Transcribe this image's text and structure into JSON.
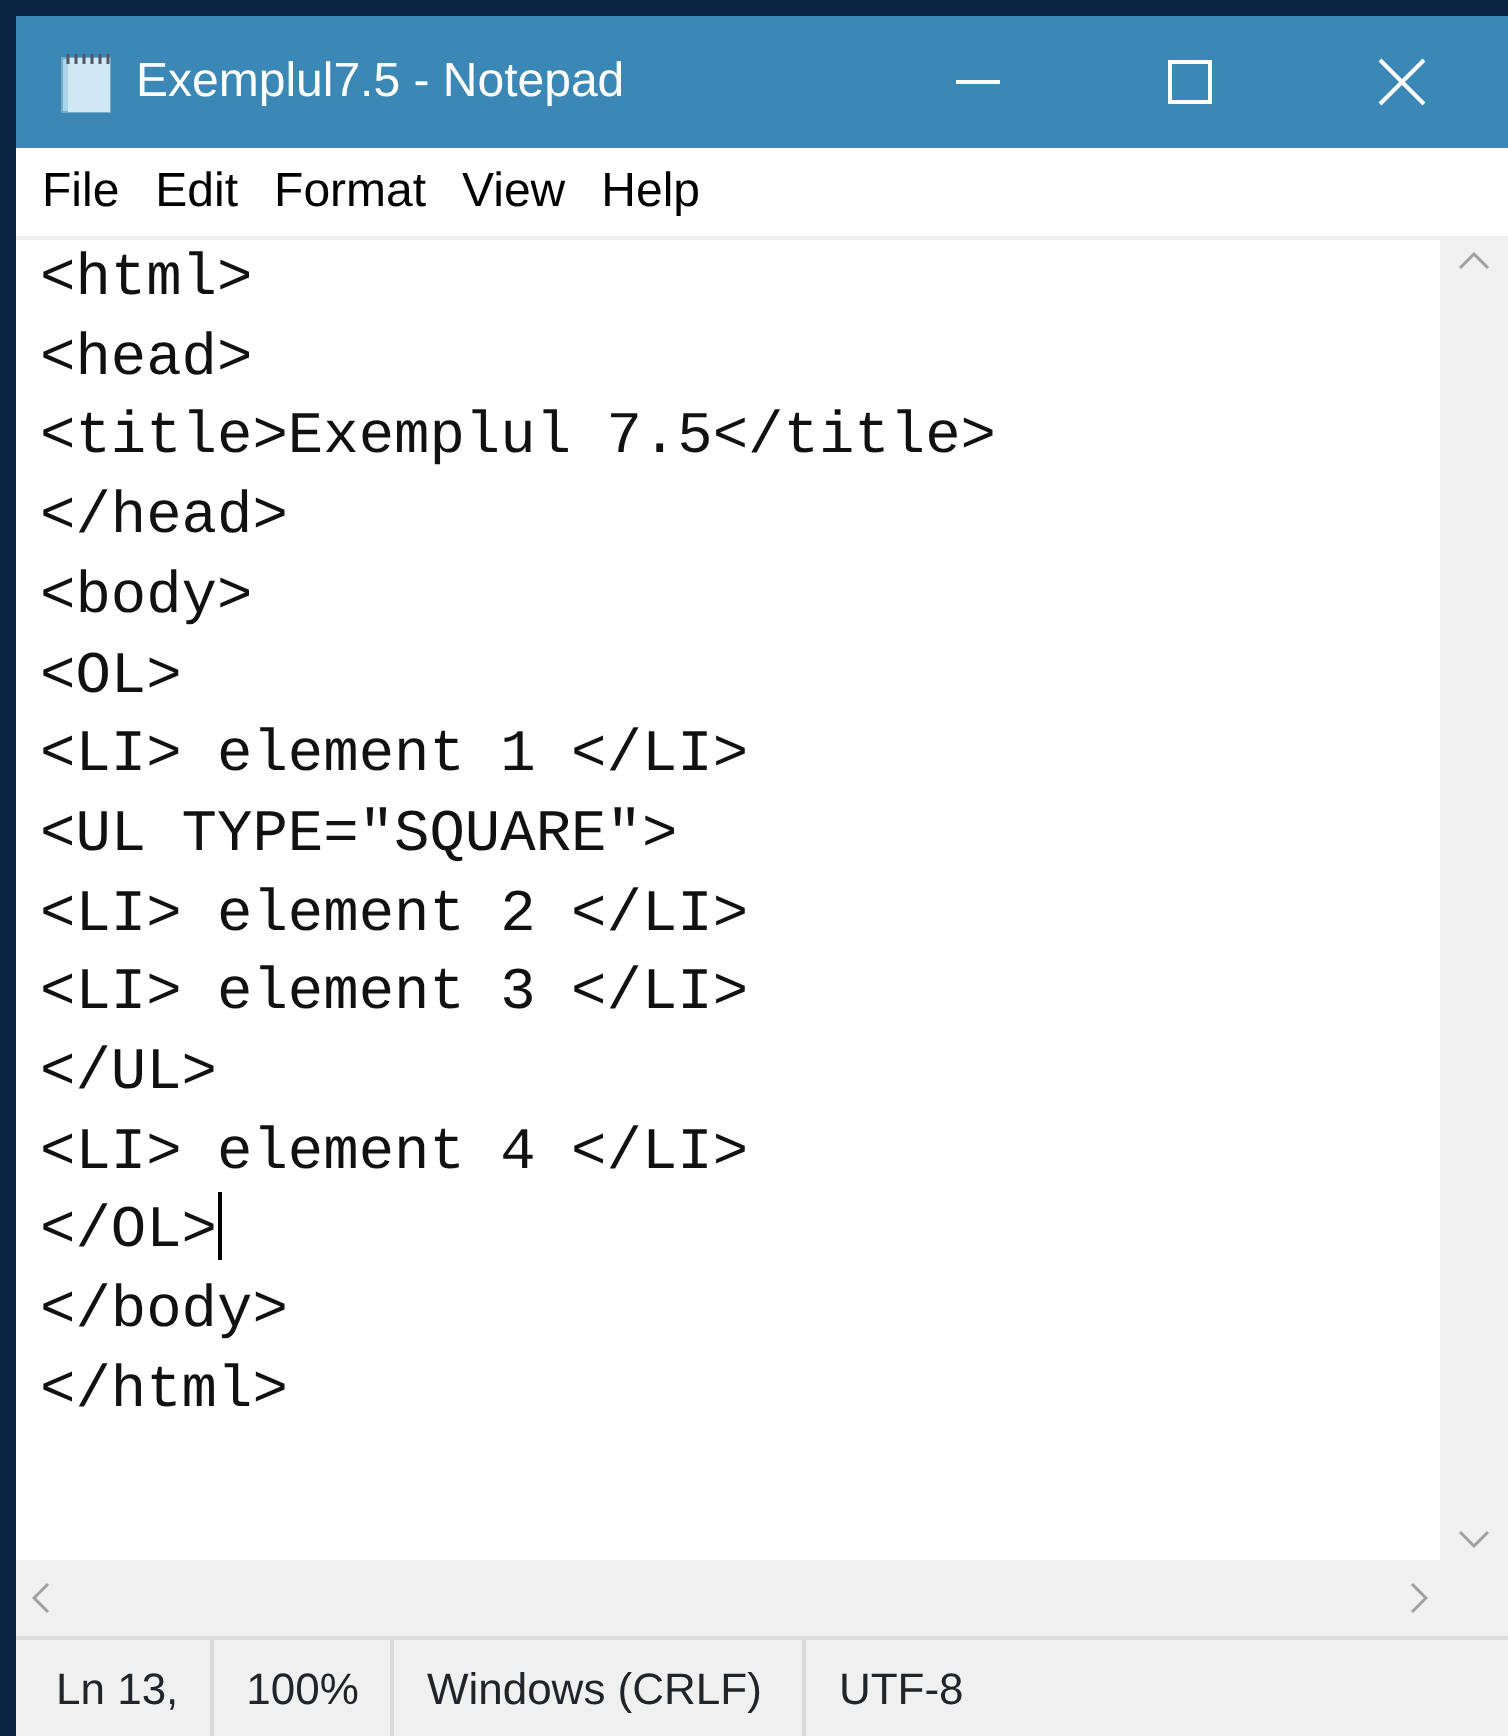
{
  "window": {
    "title": "Exemplul7.5 - Notepad"
  },
  "menu": [
    {
      "label": "File"
    },
    {
      "label": "Edit"
    },
    {
      "label": "Format"
    },
    {
      "label": "View"
    },
    {
      "label": "Help"
    }
  ],
  "editor": {
    "lines": [
      {
        "text": "<html>",
        "caret": false
      },
      {
        "text": "<head>",
        "caret": false
      },
      {
        "text": "<title>Exemplul 7.5</title>",
        "caret": false
      },
      {
        "text": "</head>",
        "caret": false
      },
      {
        "text": "<body>",
        "caret": false
      },
      {
        "text": "<OL>",
        "caret": false
      },
      {
        "text": "<LI> element 1 </LI>",
        "caret": false
      },
      {
        "text": "<UL TYPE=\"SQUARE\">",
        "caret": false
      },
      {
        "text": "<LI> element 2 </LI>",
        "caret": false
      },
      {
        "text": "<LI> element 3 </LI>",
        "caret": false
      },
      {
        "text": "</UL>",
        "caret": false
      },
      {
        "text": "<LI> element 4 </LI>",
        "caret": false
      },
      {
        "text": "</OL>",
        "caret": true
      },
      {
        "text": "</body>",
        "caret": false
      },
      {
        "text": "</html>",
        "caret": false
      }
    ]
  },
  "status_bar": [
    "Ln 13,",
    "100%",
    "Windows (CRLF)",
    "UTF-8"
  ]
}
